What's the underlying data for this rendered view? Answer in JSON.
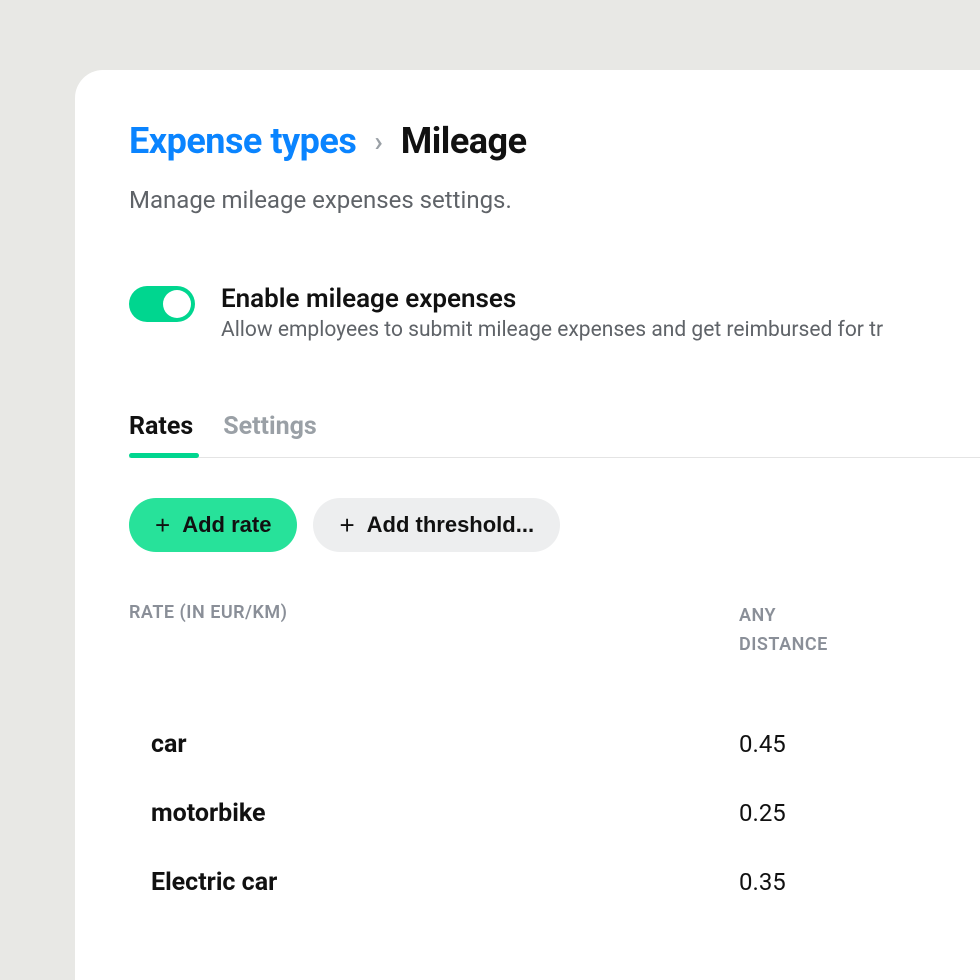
{
  "breadcrumb": {
    "parent": "Expense types",
    "current": "Mileage"
  },
  "subtitle": "Manage mileage expenses settings.",
  "toggle": {
    "enabled": true,
    "title": "Enable mileage expenses",
    "description": "Allow employees to submit mileage expenses and get reimbursed for tr"
  },
  "tabs": [
    {
      "label": "Rates",
      "active": true
    },
    {
      "label": "Settings",
      "active": false
    }
  ],
  "buttons": {
    "add_rate": "Add rate",
    "add_threshold": "Add threshold..."
  },
  "table": {
    "col_rate": "RATE (IN EUR/KM)",
    "col_any_1": "ANY",
    "col_any_2": "DISTANCE",
    "rows": [
      {
        "name": "car",
        "value": "0.45"
      },
      {
        "name": "motorbike",
        "value": "0.25"
      },
      {
        "name": "Electric car",
        "value": "0.35"
      }
    ]
  }
}
